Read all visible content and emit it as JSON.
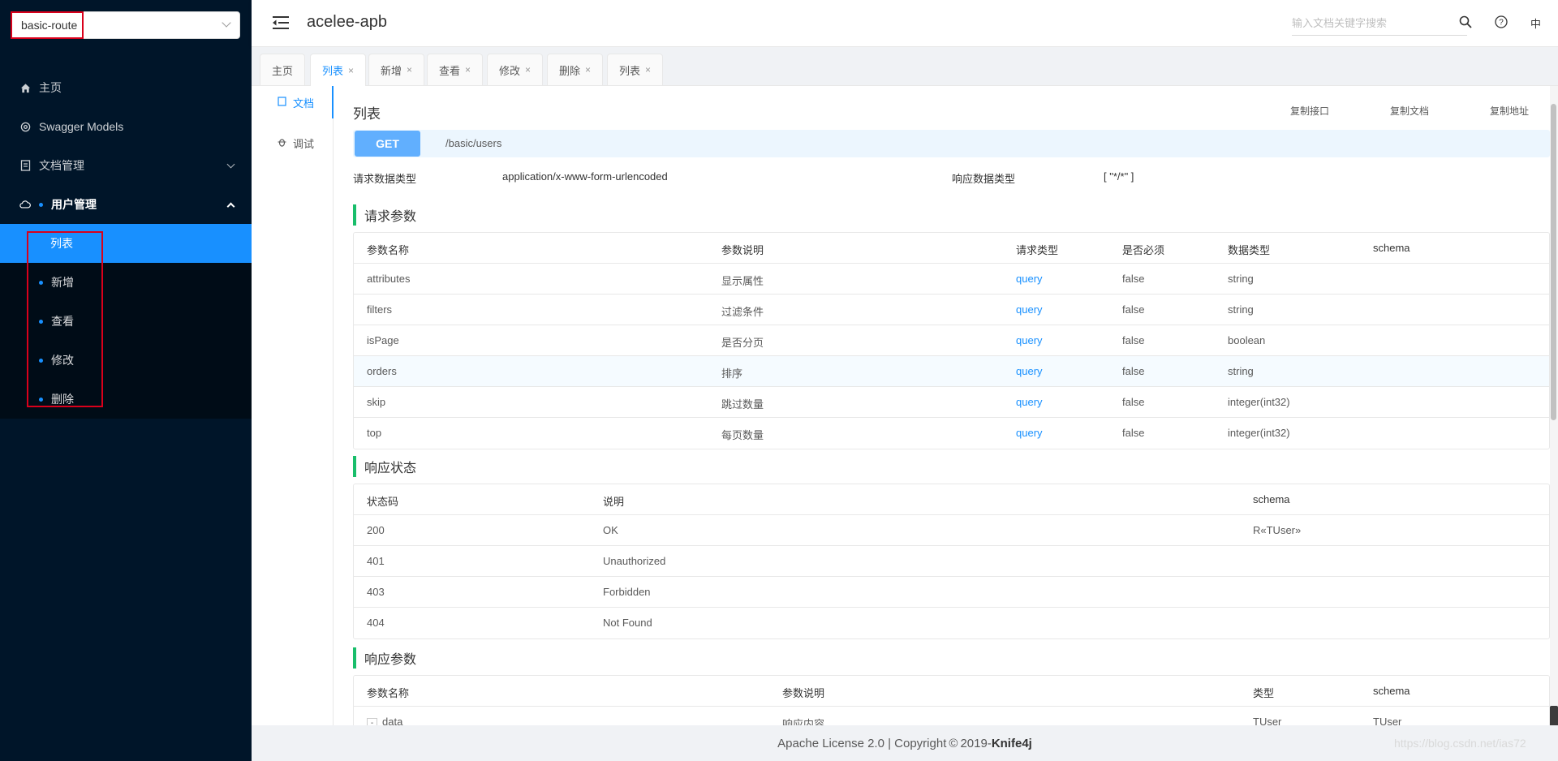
{
  "sidebar": {
    "group_select": {
      "value": "basic-route"
    },
    "menu": [
      {
        "label": "主页",
        "icon": "home-icon"
      },
      {
        "label": "Swagger Models",
        "icon": "settings-icon"
      },
      {
        "label": "文档管理",
        "icon": "document-icon"
      },
      {
        "label": "用户管理",
        "icon": "cloud-icon"
      }
    ],
    "submenu": [
      {
        "label": "列表",
        "active": true
      },
      {
        "label": "新增"
      },
      {
        "label": "查看"
      },
      {
        "label": "修改"
      },
      {
        "label": "删除"
      }
    ]
  },
  "header": {
    "title": "acelee-apb",
    "search_placeholder": "输入文档关键字搜索",
    "lang": "中"
  },
  "tabs": [
    {
      "label": "主页",
      "closable": false
    },
    {
      "label": "列表",
      "closable": true,
      "active": true
    },
    {
      "label": "新增",
      "closable": true
    },
    {
      "label": "查看",
      "closable": true
    },
    {
      "label": "修改",
      "closable": true
    },
    {
      "label": "删除",
      "closable": true
    },
    {
      "label": "列表",
      "closable": true
    }
  ],
  "tab_close_glyph": "×",
  "vtabs": [
    {
      "label": "文档",
      "active": true
    },
    {
      "label": "调试"
    }
  ],
  "doc": {
    "title": "列表",
    "actions": [
      "复制接口",
      "复制文档",
      "复制地址"
    ],
    "method": "GET",
    "path": "/basic/users",
    "request_type_label": "请求数据类型",
    "request_type_value": "application/x-www-form-urlencoded",
    "response_type_label": "响应数据类型",
    "response_type_value": "[ \"*/*\" ]",
    "request_params": {
      "title": "请求参数",
      "headers": [
        "参数名称",
        "参数说明",
        "请求类型",
        "是否必须",
        "数据类型",
        "schema"
      ],
      "rows": [
        [
          "attributes",
          "显示属性",
          "query",
          "false",
          "string",
          ""
        ],
        [
          "filters",
          "过滤条件",
          "query",
          "false",
          "string",
          ""
        ],
        [
          "isPage",
          "是否分页",
          "query",
          "false",
          "boolean",
          ""
        ],
        [
          "orders",
          "排序",
          "query",
          "false",
          "string",
          ""
        ],
        [
          "skip",
          "跳过数量",
          "query",
          "false",
          "integer(int32)",
          ""
        ],
        [
          "top",
          "每页数量",
          "query",
          "false",
          "integer(int32)",
          ""
        ]
      ]
    },
    "response_status": {
      "title": "响应状态",
      "headers": [
        "状态码",
        "说明",
        "schema"
      ],
      "rows": [
        [
          "200",
          "OK",
          "R«TUser»"
        ],
        [
          "401",
          "Unauthorized",
          ""
        ],
        [
          "403",
          "Forbidden",
          ""
        ],
        [
          "404",
          "Not Found",
          ""
        ]
      ]
    },
    "response_params": {
      "title": "响应参数",
      "headers": [
        "参数名称",
        "参数说明",
        "类型",
        "schema"
      ],
      "rows": [
        [
          "data",
          "响应内容",
          "TUser",
          "TUser"
        ]
      ],
      "expander": "-"
    }
  },
  "footer": {
    "text": "Apache License 2.0 | Copyright",
    "copyright_symbol": "©",
    "year": "2019-",
    "brand": "Knife4j"
  },
  "watermark": "https://blog.csdn.net/ias72"
}
